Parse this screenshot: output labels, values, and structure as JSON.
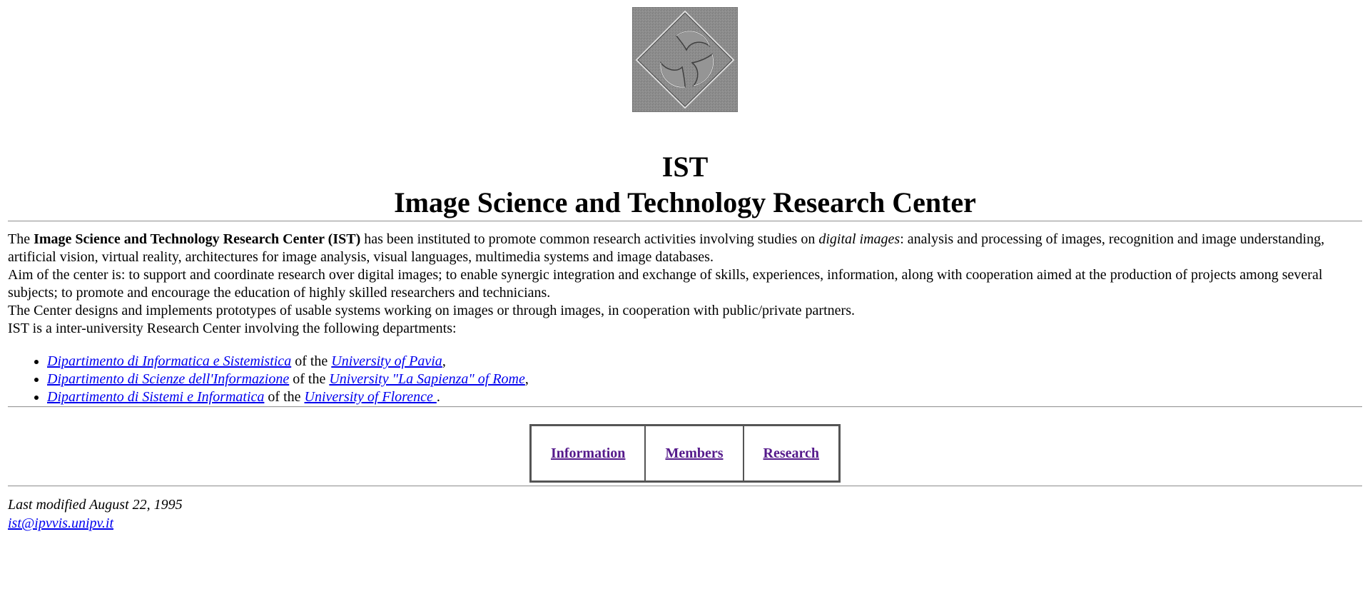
{
  "logo": {
    "icon": "ist-emblem-icon",
    "bg_color": "#8a8a8a"
  },
  "header": {
    "acronym": "IST",
    "full_name": "Image Science and Technology Research Center"
  },
  "intro": {
    "p1_the": "The ",
    "p1_bold": "Image Science and Technology Research Center (IST)",
    "p1_mid": " has been instituted to promote common research activities involving studies on ",
    "p1_italic": "digital images",
    "p1_end": ": analysis and processing of images, recognition and image understanding, artificial vision, virtual reality, architectures for image analysis, visual languages, multimedia systems and image databases.",
    "p2": "Aim of the center is: to support and coordinate research over digital images; to enable synergic integration and exchange of skills, experiences, information, along with cooperation aimed at the production of projects among several subjects; to promote and encourage the education of highly skilled researchers and technicians.",
    "p3": "The Center designs and implements prototypes of usable systems working on images or through images, in cooperation with public/private partners.",
    "p4": "IST is a inter-university Research Center involving the following departments:"
  },
  "departments": [
    {
      "dept": "Dipartimento di Informatica e Sistemistica",
      "of": " of the ",
      "university": "University of Pavia",
      "end": ","
    },
    {
      "dept": "Dipartimento di Scienze dell'Informazione",
      "of": " of the ",
      "university": "University \"La Sapienza\" of Rome",
      "end": ","
    },
    {
      "dept": "Dipartimento di Sistemi e Informatica",
      "of": " of the ",
      "university": "University of Florence ",
      "end": "."
    }
  ],
  "nav": {
    "information": "Information",
    "members": "Members",
    "research": "Research"
  },
  "footer": {
    "modified": "Last modified August 22, 1995",
    "email": "ist@ipvvis.unipv.it"
  },
  "colors": {
    "link": "#0000ee",
    "visited": "#551a8b"
  }
}
